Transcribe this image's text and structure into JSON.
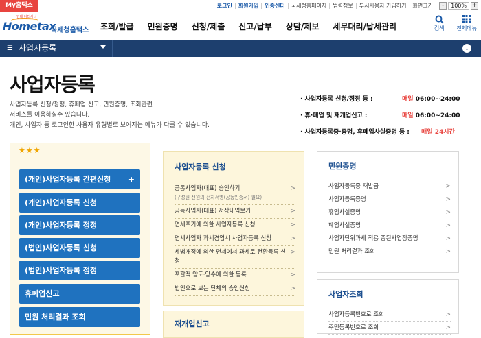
{
  "topbar": {
    "my_hometax": "My홈택스",
    "links": [
      "로그인",
      "회원가입",
      "인증센터",
      "국세청홈페이지",
      "법령정보",
      "부서사용자 가입하기",
      "화면크기"
    ],
    "zoom_minus": "-",
    "zoom_value": "100%",
    "zoom_plus": "+"
  },
  "header": {
    "logo_tag": "언제 어디서나",
    "logo_text": "Hometax",
    "logo_sub": "국세청홈택스",
    "menu": [
      "조회/발급",
      "민원증명",
      "신청/제출",
      "신고/납부",
      "상담/제보",
      "세무대리/납세관리"
    ],
    "search_label": "검색",
    "allmenu_label": "전체메뉴"
  },
  "navbar": {
    "current": "사업자등록"
  },
  "page": {
    "title": "사업자등록",
    "desc_lines": [
      "사업자등록 신청/정정, 휴폐업 신고, 민원증명, 조회관련",
      "서비스를 이용하실수 있습니다.",
      "개인, 사업자 등 로그인한 사용자 유형별로 보여지는 메뉴가 다를 수 있습니다."
    ],
    "hours": [
      {
        "label": "· 사업자등록 신청/정정 등 :",
        "day": "매일",
        "time": " 06:00~24:00"
      },
      {
        "label": "· 휴·폐업 및 재개업신고 :",
        "day": "매일",
        "time": " 06:00~24:00"
      },
      {
        "label": "· 사업자등록증·증명, 휴폐업사실증명 등 :",
        "day": "매일",
        "time": " 24시간"
      }
    ]
  },
  "quick": {
    "stars": "★★★",
    "buttons": [
      "(개인)사업자등록 간편신청",
      "(개인)사업자등록 신청",
      "(개인)사업자등록 정정",
      "(법인)사업자등록 신청",
      "(법인)사업자등록 정정",
      "휴폐업신고",
      "민원 처리결과 조회"
    ],
    "plus": "+"
  },
  "apply_panel": {
    "heading": "사업자등록 신청",
    "items": [
      {
        "label": "공동사업자(대표) 승인하기",
        "note": "(구성원 전원의 전자서명(공동인증서) 필요)"
      },
      {
        "label": "공동사업자(대표) 저장내역보기",
        "note": ""
      },
      {
        "label": "면세포기에 의한 사업자등록 신청",
        "note": ""
      },
      {
        "label": "면세사업자 과세겸업시 사업자등록 신청",
        "note": ""
      },
      {
        "label": "세법개정에 의한 면세에서 과세로 전환등록 신청",
        "note": ""
      },
      {
        "label": "포괄적 양도·양수에 의한 등록",
        "note": ""
      },
      {
        "label": "법인으로 보는 단체의 승인신청",
        "note": ""
      }
    ],
    "arrow": ">"
  },
  "reopen_panel": {
    "heading": "재개업신고"
  },
  "cert_panel": {
    "heading": "민원증명",
    "items": [
      "사업자등록증 재발급",
      "사업자등록증명",
      "휴업사실증명",
      "폐업사실증명",
      "사업자단위과세 적용 종된사업장증명",
      "민원 처리결과 조회"
    ]
  },
  "inquiry_panel": {
    "heading": "사업자조회",
    "items": [
      "사업자등록번호로 조회",
      "주민등록번호로 조회"
    ]
  },
  "colors": {
    "accent_red": "#e8443f",
    "brand_blue": "#1b5aa8",
    "navbar": "#1d3f6e",
    "button_blue": "#1f72bf",
    "panel_yellow": "#fdf6dc"
  }
}
